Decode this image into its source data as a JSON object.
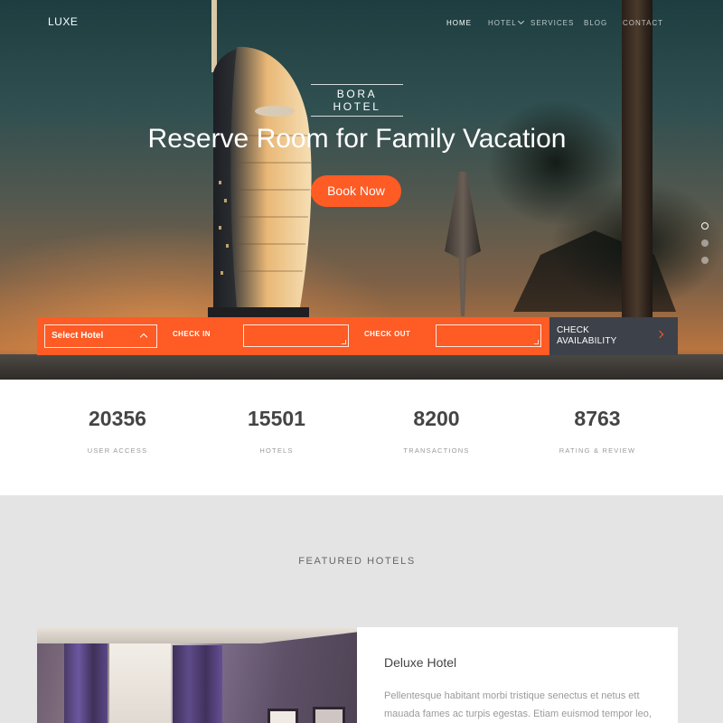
{
  "brand": "LUXE",
  "nav": {
    "home": "HOME",
    "hotel": "HOTEL",
    "services": "SERVICES",
    "blog": "BLOG",
    "contact": "CONTACT"
  },
  "hero": {
    "kicker": "BORA HOTEL",
    "headline": "Reserve Room for Family Vacation",
    "cta": "Book Now",
    "slides": 3,
    "active_slide": 1
  },
  "booking": {
    "select_hotel": "Select Hotel",
    "check_in_label": "CHECK IN",
    "check_in_value": "",
    "check_out_label": "CHECK OUT",
    "check_out_value": "",
    "check_availability_line1": "CHECK",
    "check_availability_line2": "AVAILABILITY"
  },
  "stats": [
    {
      "value": "20356",
      "label": "USER ACCESS"
    },
    {
      "value": "15501",
      "label": "HOTELS"
    },
    {
      "value": "8200",
      "label": "TRANSACTIONS"
    },
    {
      "value": "8763",
      "label": "RATING & REVIEW"
    }
  ],
  "featured": {
    "title": "FEATURED HOTELS",
    "card": {
      "name": "Deluxe Hotel",
      "description": "Pellentesque habitant morbi tristique senectus et netus ett mauada fames ac turpis egestas. Etiam euismod tempor leo,"
    }
  },
  "colors": {
    "accent": "#fe5b25",
    "dark_button": "#3d4149",
    "stats_number": "#444444",
    "section_bg": "#e4e4e4"
  }
}
